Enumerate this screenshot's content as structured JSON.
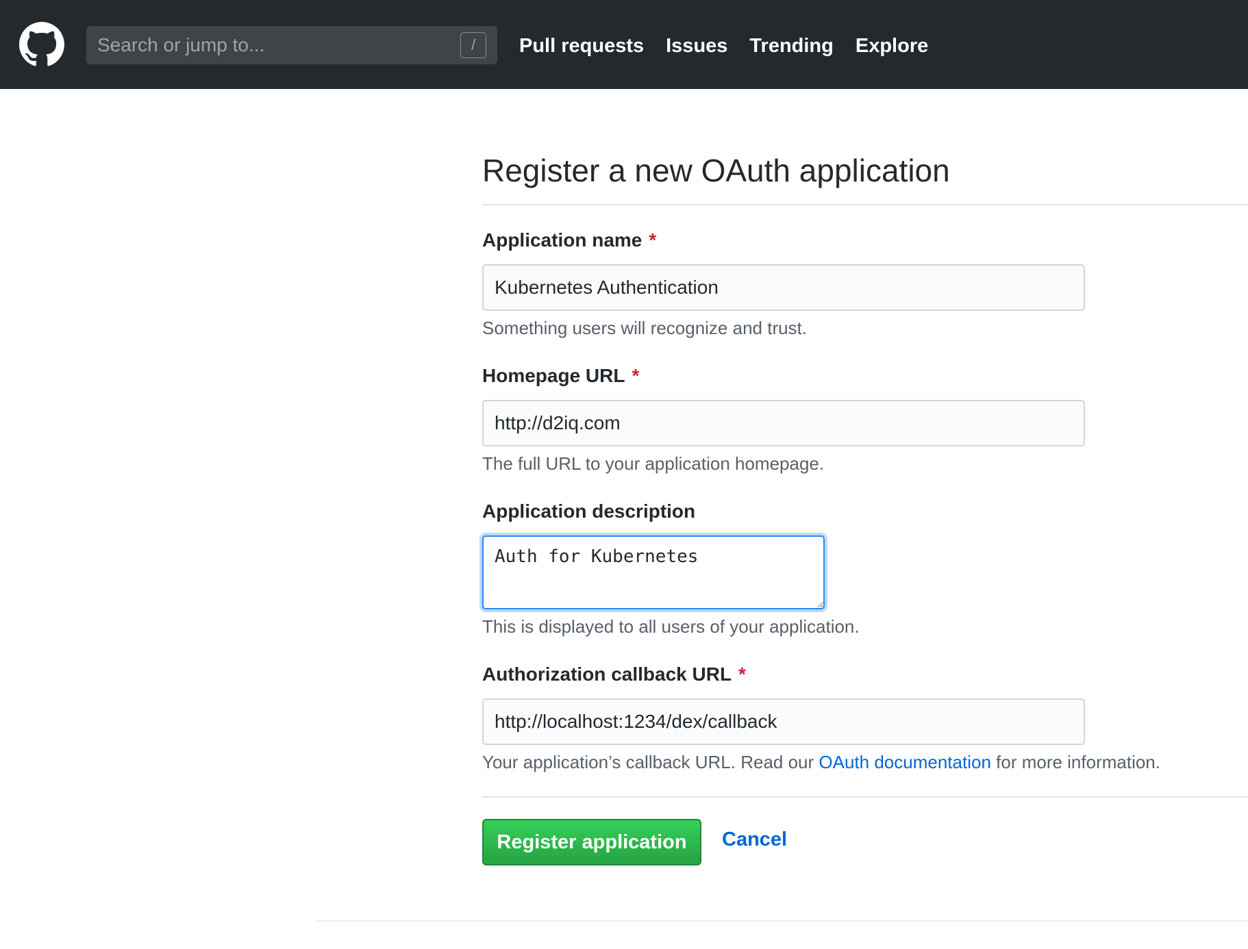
{
  "header": {
    "search_placeholder": "Search or jump to...",
    "search_shortcut": "/",
    "nav": [
      "Pull requests",
      "Issues",
      "Trending",
      "Explore"
    ]
  },
  "page": {
    "title": "Register a new OAuth application"
  },
  "form": {
    "app_name": {
      "label": "Application name",
      "required_marker": "*",
      "value": "Kubernetes Authentication",
      "help": "Something users will recognize and trust."
    },
    "homepage_url": {
      "label": "Homepage URL",
      "required_marker": "*",
      "value": "http://d2iq.com",
      "help": "The full URL to your application homepage."
    },
    "description": {
      "label": "Application description",
      "value": "Auth for Kubernetes",
      "help": "This is displayed to all users of your application."
    },
    "callback_url": {
      "label": "Authorization callback URL",
      "required_marker": "*",
      "value": "http://localhost:1234/dex/callback",
      "help_before": "Your application’s callback URL. Read our ",
      "help_link": "OAuth documentation",
      "help_after": " for more information."
    }
  },
  "actions": {
    "register_label": "Register application",
    "cancel_label": "Cancel"
  },
  "colors": {
    "header_bg": "#24292e",
    "link": "#0366d6",
    "required": "#cb2431",
    "button_green": "#28a745",
    "focus_border": "#2188ff"
  }
}
